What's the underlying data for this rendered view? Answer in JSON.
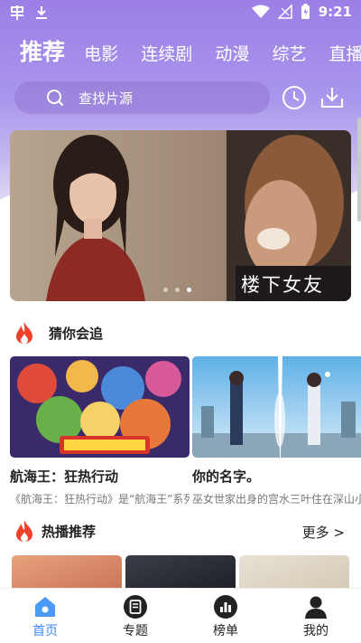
{
  "status_bar": {
    "time": "9:21"
  },
  "tabs": [
    {
      "label": "推荐"
    },
    {
      "label": "电影"
    },
    {
      "label": "连续剧"
    },
    {
      "label": "动漫"
    },
    {
      "label": "综艺"
    },
    {
      "label": "直播"
    }
  ],
  "search": {
    "placeholder": "查找片源"
  },
  "banner": {
    "caption": "楼下女友",
    "slide_count": 3,
    "active_slide": 1
  },
  "section_guess": {
    "title": "猜你会追",
    "cards": [
      {
        "title": "航海王：狂热行动",
        "desc": "《航海王：狂热行动》是“航海王”系列剧场版"
      },
      {
        "title": "你的名字。",
        "desc": "巫女世家出身的宫水三叶住在深山小镇"
      }
    ]
  },
  "section_hot": {
    "title": "热播推荐",
    "more_label": "更多 >"
  },
  "bottom_nav": [
    {
      "label": "首页"
    },
    {
      "label": "专题"
    },
    {
      "label": "榜单"
    },
    {
      "label": "我的"
    }
  ],
  "colors": {
    "accent": "#9b7fe6",
    "nav_active": "#3d8af7",
    "flame": "#f0402a"
  },
  "icons": {
    "history": "clock-icon",
    "download": "download-icon",
    "search": "search-icon",
    "section": "flame-icon"
  }
}
